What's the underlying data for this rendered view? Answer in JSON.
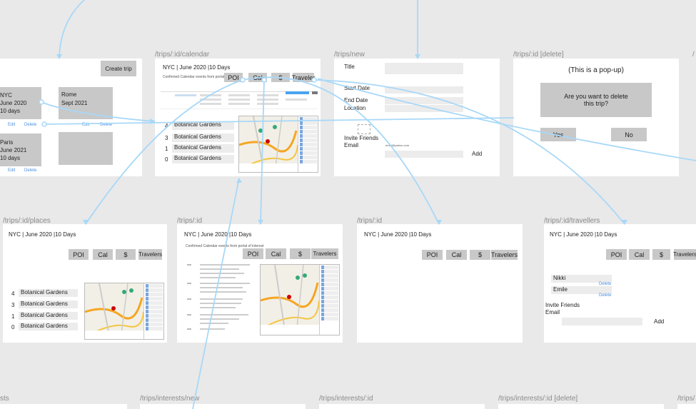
{
  "routes": {
    "calendar": "/trips/:id/calendar",
    "new": "/trips/new",
    "delete": "/trips/:id [delete]",
    "places": "/trips/:id/places",
    "id1": "/trips/:id",
    "id2": "/trips/:id",
    "travellers": "/trips/:id/travellers",
    "interests": "sts",
    "interests_new": "/trips/interests/new",
    "interests_id": "/trips/interests/:id",
    "interests_delete": "/trips/interests/:id [delete]",
    "interests_cut": "/trips/"
  },
  "index": {
    "create_trip": "Create trip",
    "trip1": [
      "NYC",
      "June 2020",
      "10 days"
    ],
    "trip2": [
      "Rome",
      "Sept 2021"
    ],
    "trip3": [
      "Paris",
      "June 2021",
      "10 days"
    ],
    "edit": "Edit",
    "delete": "Delete"
  },
  "trip_title": "NYC | June 2020 |10 Days",
  "calendar": {
    "subtitle": "Confirmed Calendar events from portal of interest",
    "poi": "POI",
    "cal": "Cal",
    "money": "$",
    "travelers": "Traveler"
  },
  "places": [
    {
      "count": "4",
      "name": "Botanical Gardens"
    },
    {
      "count": "3",
      "name": "Botanical Gardens"
    },
    {
      "count": "1",
      "name": "Botanical Gardens"
    },
    {
      "count": "0",
      "name": "Botanical Gardens"
    }
  ],
  "new_trip": {
    "title": "Title",
    "start": "Start Date",
    "end": "End Date",
    "location": "Location",
    "invite": "Invite Friends",
    "email": "Email",
    "email_value": "email@yahoo.com",
    "add": "Add"
  },
  "delete_popup": {
    "note": "(This is a pop-up)",
    "question": "Are you want to delete this trip?",
    "yes": "Yes",
    "no": "No"
  },
  "nav": {
    "poi": "POI",
    "cal": "Cal",
    "money": "$",
    "travelers": "Travelers"
  },
  "id_subtitle": "Confirmed Calendar events from portal of interest",
  "travellers": {
    "names": [
      "Nikki",
      "Emile"
    ],
    "delete": "Delete",
    "invite": "Invite Friends",
    "email": "Email",
    "add": "Add"
  },
  "colors": {
    "background": "#e9e9e9",
    "frame": "#ffffff",
    "gray_button": "#c8c8c8",
    "flow_arrow": "#a8d8f8",
    "link": "#4a90e2"
  }
}
